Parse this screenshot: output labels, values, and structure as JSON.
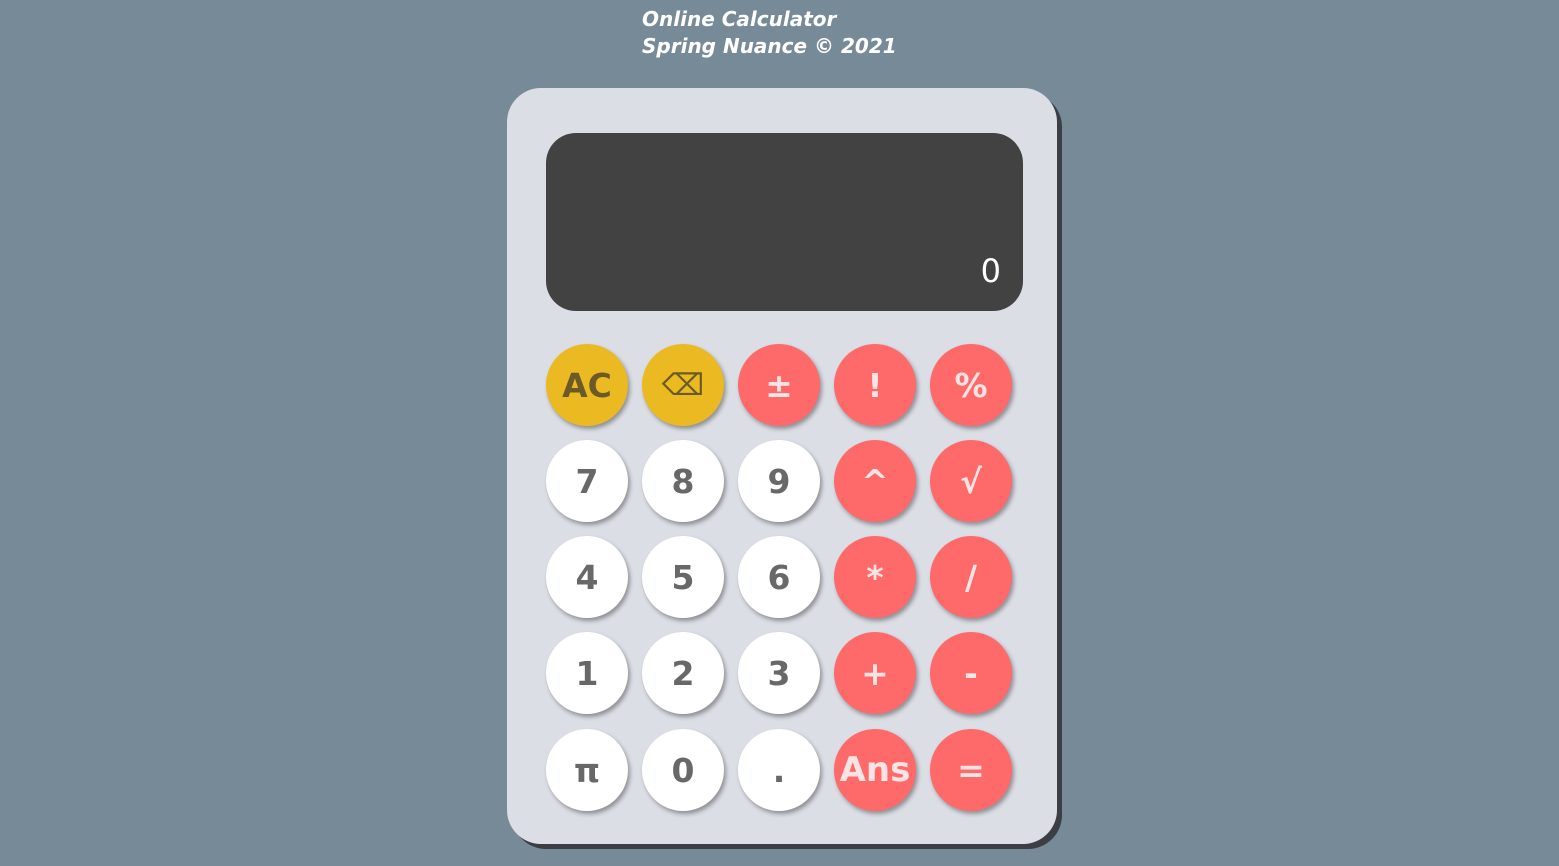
{
  "header": {
    "title": "Online Calculator",
    "credit": "Spring Nuance © 2021"
  },
  "display": {
    "value": "0"
  },
  "keys": {
    "row1": [
      {
        "label": "AC",
        "style": "yellow",
        "name": "clear-button"
      },
      {
        "label": "⌫",
        "style": "yellow",
        "name": "backspace-button"
      },
      {
        "label": "±",
        "style": "red",
        "name": "sign-toggle-button"
      },
      {
        "label": "!",
        "style": "red",
        "name": "factorial-button"
      },
      {
        "label": "%",
        "style": "red",
        "name": "percent-button"
      }
    ],
    "row2": [
      {
        "label": "7",
        "style": "white",
        "name": "digit-7-button"
      },
      {
        "label": "8",
        "style": "white",
        "name": "digit-8-button"
      },
      {
        "label": "9",
        "style": "white",
        "name": "digit-9-button"
      },
      {
        "label": "^",
        "style": "red",
        "name": "power-button"
      },
      {
        "label": "√",
        "style": "red",
        "name": "sqrt-button"
      }
    ],
    "row3": [
      {
        "label": "4",
        "style": "white",
        "name": "digit-4-button"
      },
      {
        "label": "5",
        "style": "white",
        "name": "digit-5-button"
      },
      {
        "label": "6",
        "style": "white",
        "name": "digit-6-button"
      },
      {
        "label": "*",
        "style": "red",
        "name": "multiply-button"
      },
      {
        "label": "/",
        "style": "red",
        "name": "divide-button"
      }
    ],
    "row4": [
      {
        "label": "1",
        "style": "white",
        "name": "digit-1-button"
      },
      {
        "label": "2",
        "style": "white",
        "name": "digit-2-button"
      },
      {
        "label": "3",
        "style": "white",
        "name": "digit-3-button"
      },
      {
        "label": "+",
        "style": "red",
        "name": "add-button"
      },
      {
        "label": "-",
        "style": "red",
        "name": "subtract-button"
      }
    ],
    "row5": [
      {
        "label": "π",
        "style": "white",
        "name": "pi-button"
      },
      {
        "label": "0",
        "style": "white",
        "name": "digit-0-button"
      },
      {
        "label": ".",
        "style": "white",
        "name": "decimal-button"
      },
      {
        "label": "Ans",
        "style": "red",
        "name": "answer-button"
      },
      {
        "label": "=",
        "style": "red",
        "name": "equals-button"
      }
    ]
  },
  "colors": {
    "background": "#778a97",
    "body": "#dcdee6",
    "display": "#424242",
    "function_key": "#ebb922",
    "operator_key": "#fe6a6a",
    "digit_key": "#ffffff"
  }
}
